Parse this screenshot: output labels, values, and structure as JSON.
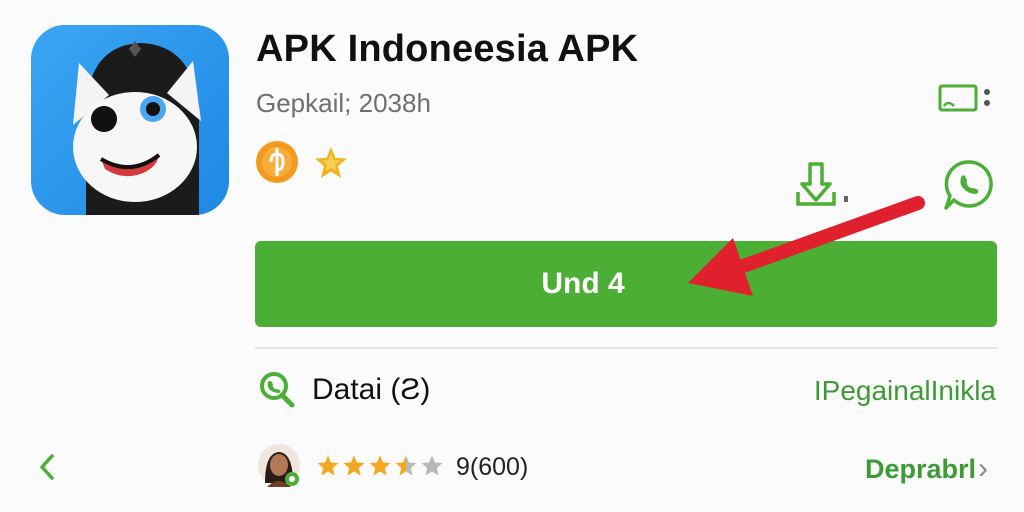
{
  "app": {
    "title": "APK Indoneesia APK",
    "subtitle": "Gepkail; 2038h",
    "icon": "ghost-face-app-icon"
  },
  "badges": [
    "coin-badge-icon",
    "star-badge-icon"
  ],
  "header_actions": {
    "cast_icon": "cast-icon",
    "download_icon": "download-icon",
    "share_icon": "whatsapp-icon"
  },
  "install_button": {
    "label": "Und 4"
  },
  "annotation": {
    "arrow": "red-pointer-arrow"
  },
  "data_row": {
    "icon": "phone-search-icon",
    "label": "Datai (Ƨ)",
    "link": "IPegainalInikla"
  },
  "review_row": {
    "back_icon": "chevron-left-icon",
    "rating": 3.5,
    "rating_max": 5,
    "count": "9(600)",
    "more_label": "Deprabrl",
    "more_chevron": "›"
  },
  "colors": {
    "accent": "#4caf35",
    "link": "#3e9a34",
    "icon_bg": "#1e88e5",
    "arrow": "#e0202c",
    "star": "#f2a821"
  }
}
